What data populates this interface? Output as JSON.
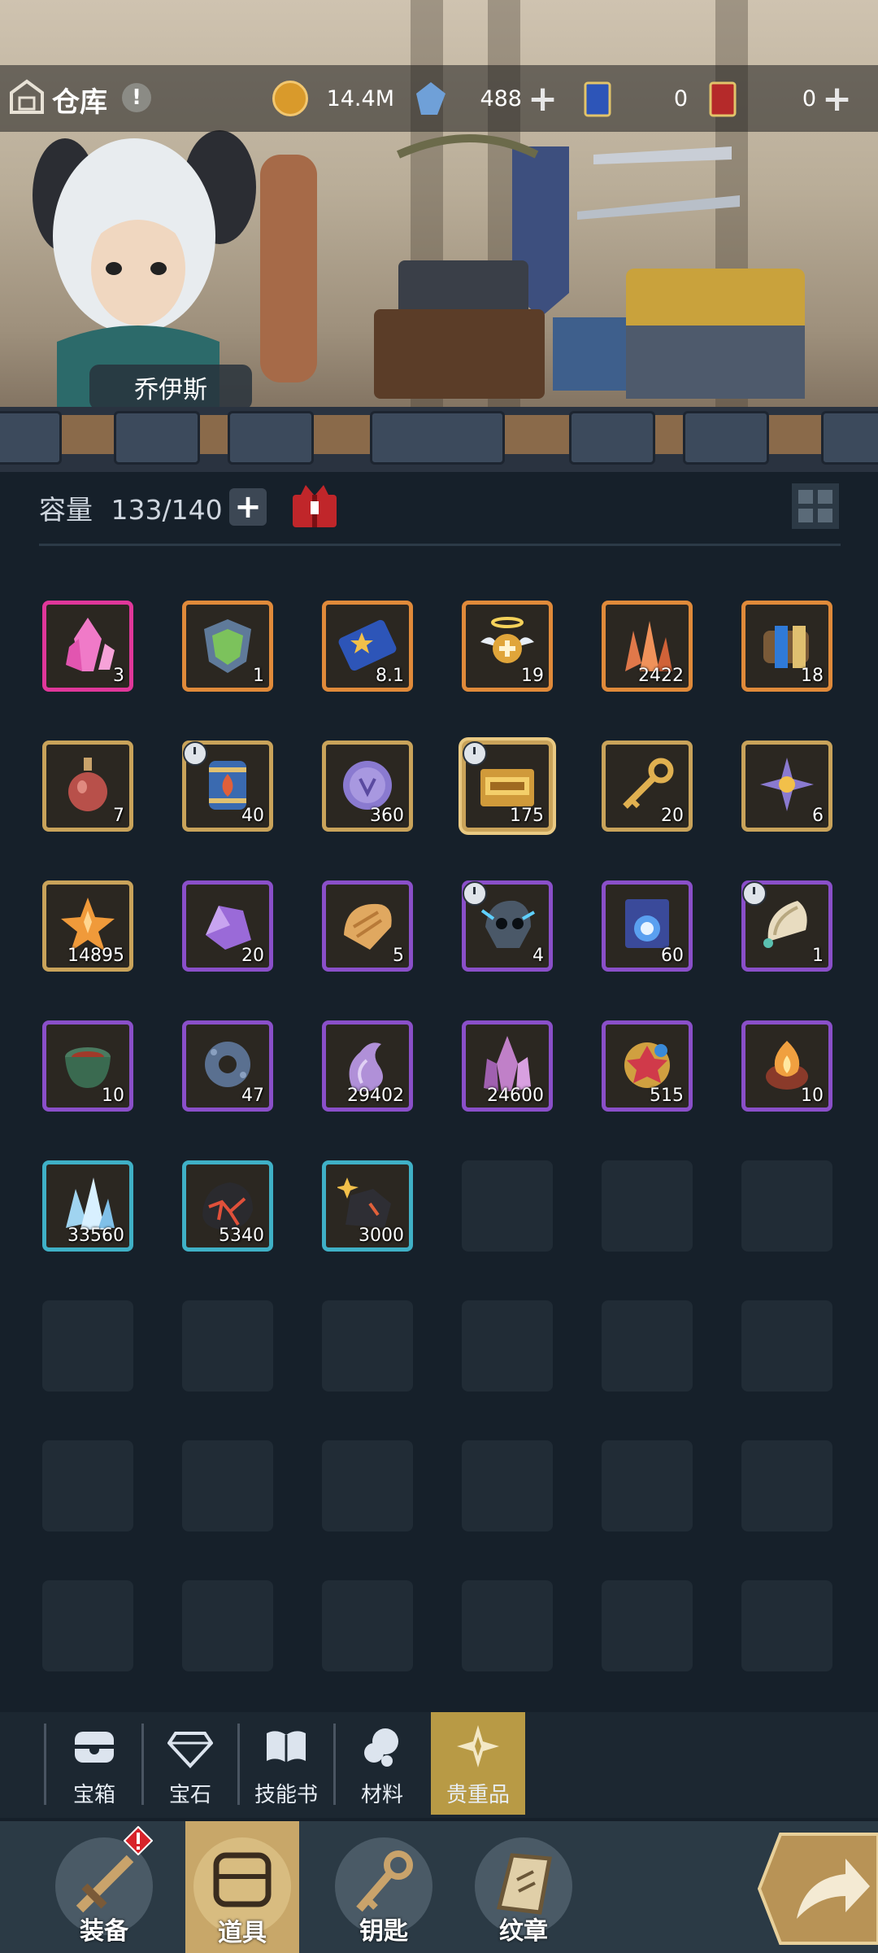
{
  "header": {
    "title": "仓库",
    "hero_name": "乔伊斯",
    "resources": [
      {
        "name": "gold",
        "value": "14.4M"
      },
      {
        "name": "crystal",
        "value": "488"
      },
      {
        "name": "ticket-blue",
        "value": "0"
      },
      {
        "name": "ticket-gold",
        "value": "0"
      }
    ],
    "plus": "+",
    "info": "!"
  },
  "capacity": {
    "label": "容量",
    "value": "133/140",
    "add": "+"
  },
  "items": [
    {
      "icon": "pink-crystal-icon",
      "count": "3",
      "rarity": "#e0379a"
    },
    {
      "icon": "green-shield-badge-icon",
      "count": "1",
      "rarity": "#e08a3a"
    },
    {
      "icon": "star-ticket-icon",
      "count": "8.1",
      "rarity": "#e08a3a"
    },
    {
      "icon": "winged-halo-icon",
      "count": "19",
      "rarity": "#e08a3a"
    },
    {
      "icon": "copper-ore-icon",
      "count": "2422",
      "rarity": "#e08a3a"
    },
    {
      "icon": "blue-scroll-icon",
      "count": "18",
      "rarity": "#e08a3a"
    },
    {
      "icon": "potion-bottle-icon",
      "count": "7",
      "rarity": "#c9a35a"
    },
    {
      "icon": "fire-barrel-icon",
      "count": "40",
      "rarity": "#c9a35a",
      "timed": true
    },
    {
      "icon": "purple-coin-icon",
      "count": "360",
      "rarity": "#c9a35a"
    },
    {
      "icon": "gold-pass-icon",
      "count": "175",
      "rarity": "#c9a35a",
      "timed": true,
      "selected": true
    },
    {
      "icon": "gold-key-icon",
      "count": "20",
      "rarity": "#c9a35a"
    },
    {
      "icon": "star-gem-icon",
      "count": "6",
      "rarity": "#c9a35a"
    },
    {
      "icon": "orange-star-crystal-icon",
      "count": "14895",
      "rarity": "#c9a35a"
    },
    {
      "icon": "amethyst-icon",
      "count": "20",
      "rarity": "#8a4fc9"
    },
    {
      "icon": "bread-icon",
      "count": "5",
      "rarity": "#8a4fc9"
    },
    {
      "icon": "skull-helmet-icon",
      "count": "4",
      "rarity": "#8a4fc9",
      "timed": true
    },
    {
      "icon": "blue-orb-scroll-icon",
      "count": "60",
      "rarity": "#8a4fc9"
    },
    {
      "icon": "shell-horn-icon",
      "count": "1",
      "rarity": "#8a4fc9",
      "timed": true
    },
    {
      "icon": "stone-bowl-icon",
      "count": "10",
      "rarity": "#8a4fc9"
    },
    {
      "icon": "gear-stone-icon",
      "count": "47",
      "rarity": "#8a4fc9"
    },
    {
      "icon": "purple-shard-icon",
      "count": "29402",
      "rarity": "#8a4fc9"
    },
    {
      "icon": "purple-crystal-cluster-icon",
      "count": "24600",
      "rarity": "#8a4fc9"
    },
    {
      "icon": "jeweled-amulet-icon",
      "count": "515",
      "rarity": "#8a4fc9"
    },
    {
      "icon": "fire-lamp-icon",
      "count": "10",
      "rarity": "#8a4fc9"
    },
    {
      "icon": "ice-crystal-icon",
      "count": "33560",
      "rarity": "#3fb0c6"
    },
    {
      "icon": "lava-rock-icon",
      "count": "5340",
      "rarity": "#3fb0c6"
    },
    {
      "icon": "dark-ore-icon",
      "count": "3000",
      "rarity": "#3fb0c6"
    }
  ],
  "tabs": [
    {
      "label": "宝箱",
      "icon": "chest-icon"
    },
    {
      "label": "宝石",
      "icon": "diamond-icon"
    },
    {
      "label": "技能书",
      "icon": "book-icon"
    },
    {
      "label": "材料",
      "icon": "material-icon"
    },
    {
      "label": "贵重品",
      "icon": "valuable-star-icon",
      "active": true
    }
  ],
  "nav": [
    {
      "label": "装备",
      "icon": "sword-icon"
    },
    {
      "label": "道具",
      "icon": "bag-icon",
      "active": true
    },
    {
      "label": "钥匙",
      "icon": "key-icon"
    },
    {
      "label": "纹章",
      "icon": "emblem-icon"
    }
  ],
  "colors": {
    "accent": "#c8a769",
    "panel": "#16202a",
    "empty_slot": "#212c36"
  }
}
